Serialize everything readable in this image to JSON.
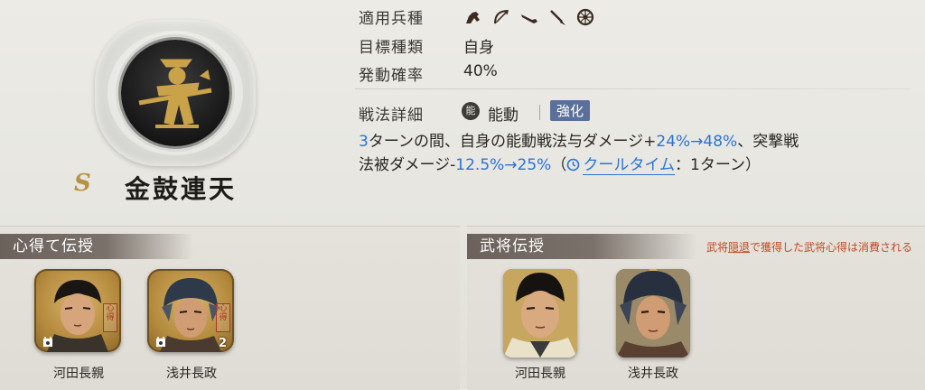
{
  "skill": {
    "rank": "S",
    "name": "金鼓連天"
  },
  "info": {
    "unit_types_label": "適用兵種",
    "unit_type_icons": [
      "cavalry-icon",
      "bow-icon",
      "gun-icon",
      "spear-icon",
      "wheel-icon"
    ],
    "target_label": "目標種類",
    "target_value": "自身",
    "chance_label": "発動確率",
    "chance_value": "40%",
    "detail_label": "戦法詳細",
    "ability_badge": "能",
    "ability_type": "能動",
    "enhance_tag": "強化"
  },
  "description": {
    "line1_turns": "3",
    "line1_text": "ターンの間、自身の能動戦法与ダメージ+",
    "line1_boost": "24%→48%",
    "line1_end": "、突撃戦",
    "line2_start": "法被ダメージ-",
    "line2_reduction": "12.5%→25%",
    "line2_paren_open": "（",
    "line2_cooldown_label": "クールタイム",
    "line2_cooldown_value": "：1ターン）"
  },
  "panels": {
    "left_title": "心得て伝授",
    "right_title": "武将伝授",
    "notice_prefix": "武将",
    "notice_underlined": "隠退",
    "notice_suffix": "で獲得した武将心得は消費される"
  },
  "left_cards": [
    {
      "name": "河田長親",
      "seal": "心得",
      "count": ""
    },
    {
      "name": "浅井長政",
      "seal": "心得",
      "count": "2"
    }
  ],
  "right_cards": [
    {
      "name": "河田長親"
    },
    {
      "name": "浅井長政"
    }
  ]
}
